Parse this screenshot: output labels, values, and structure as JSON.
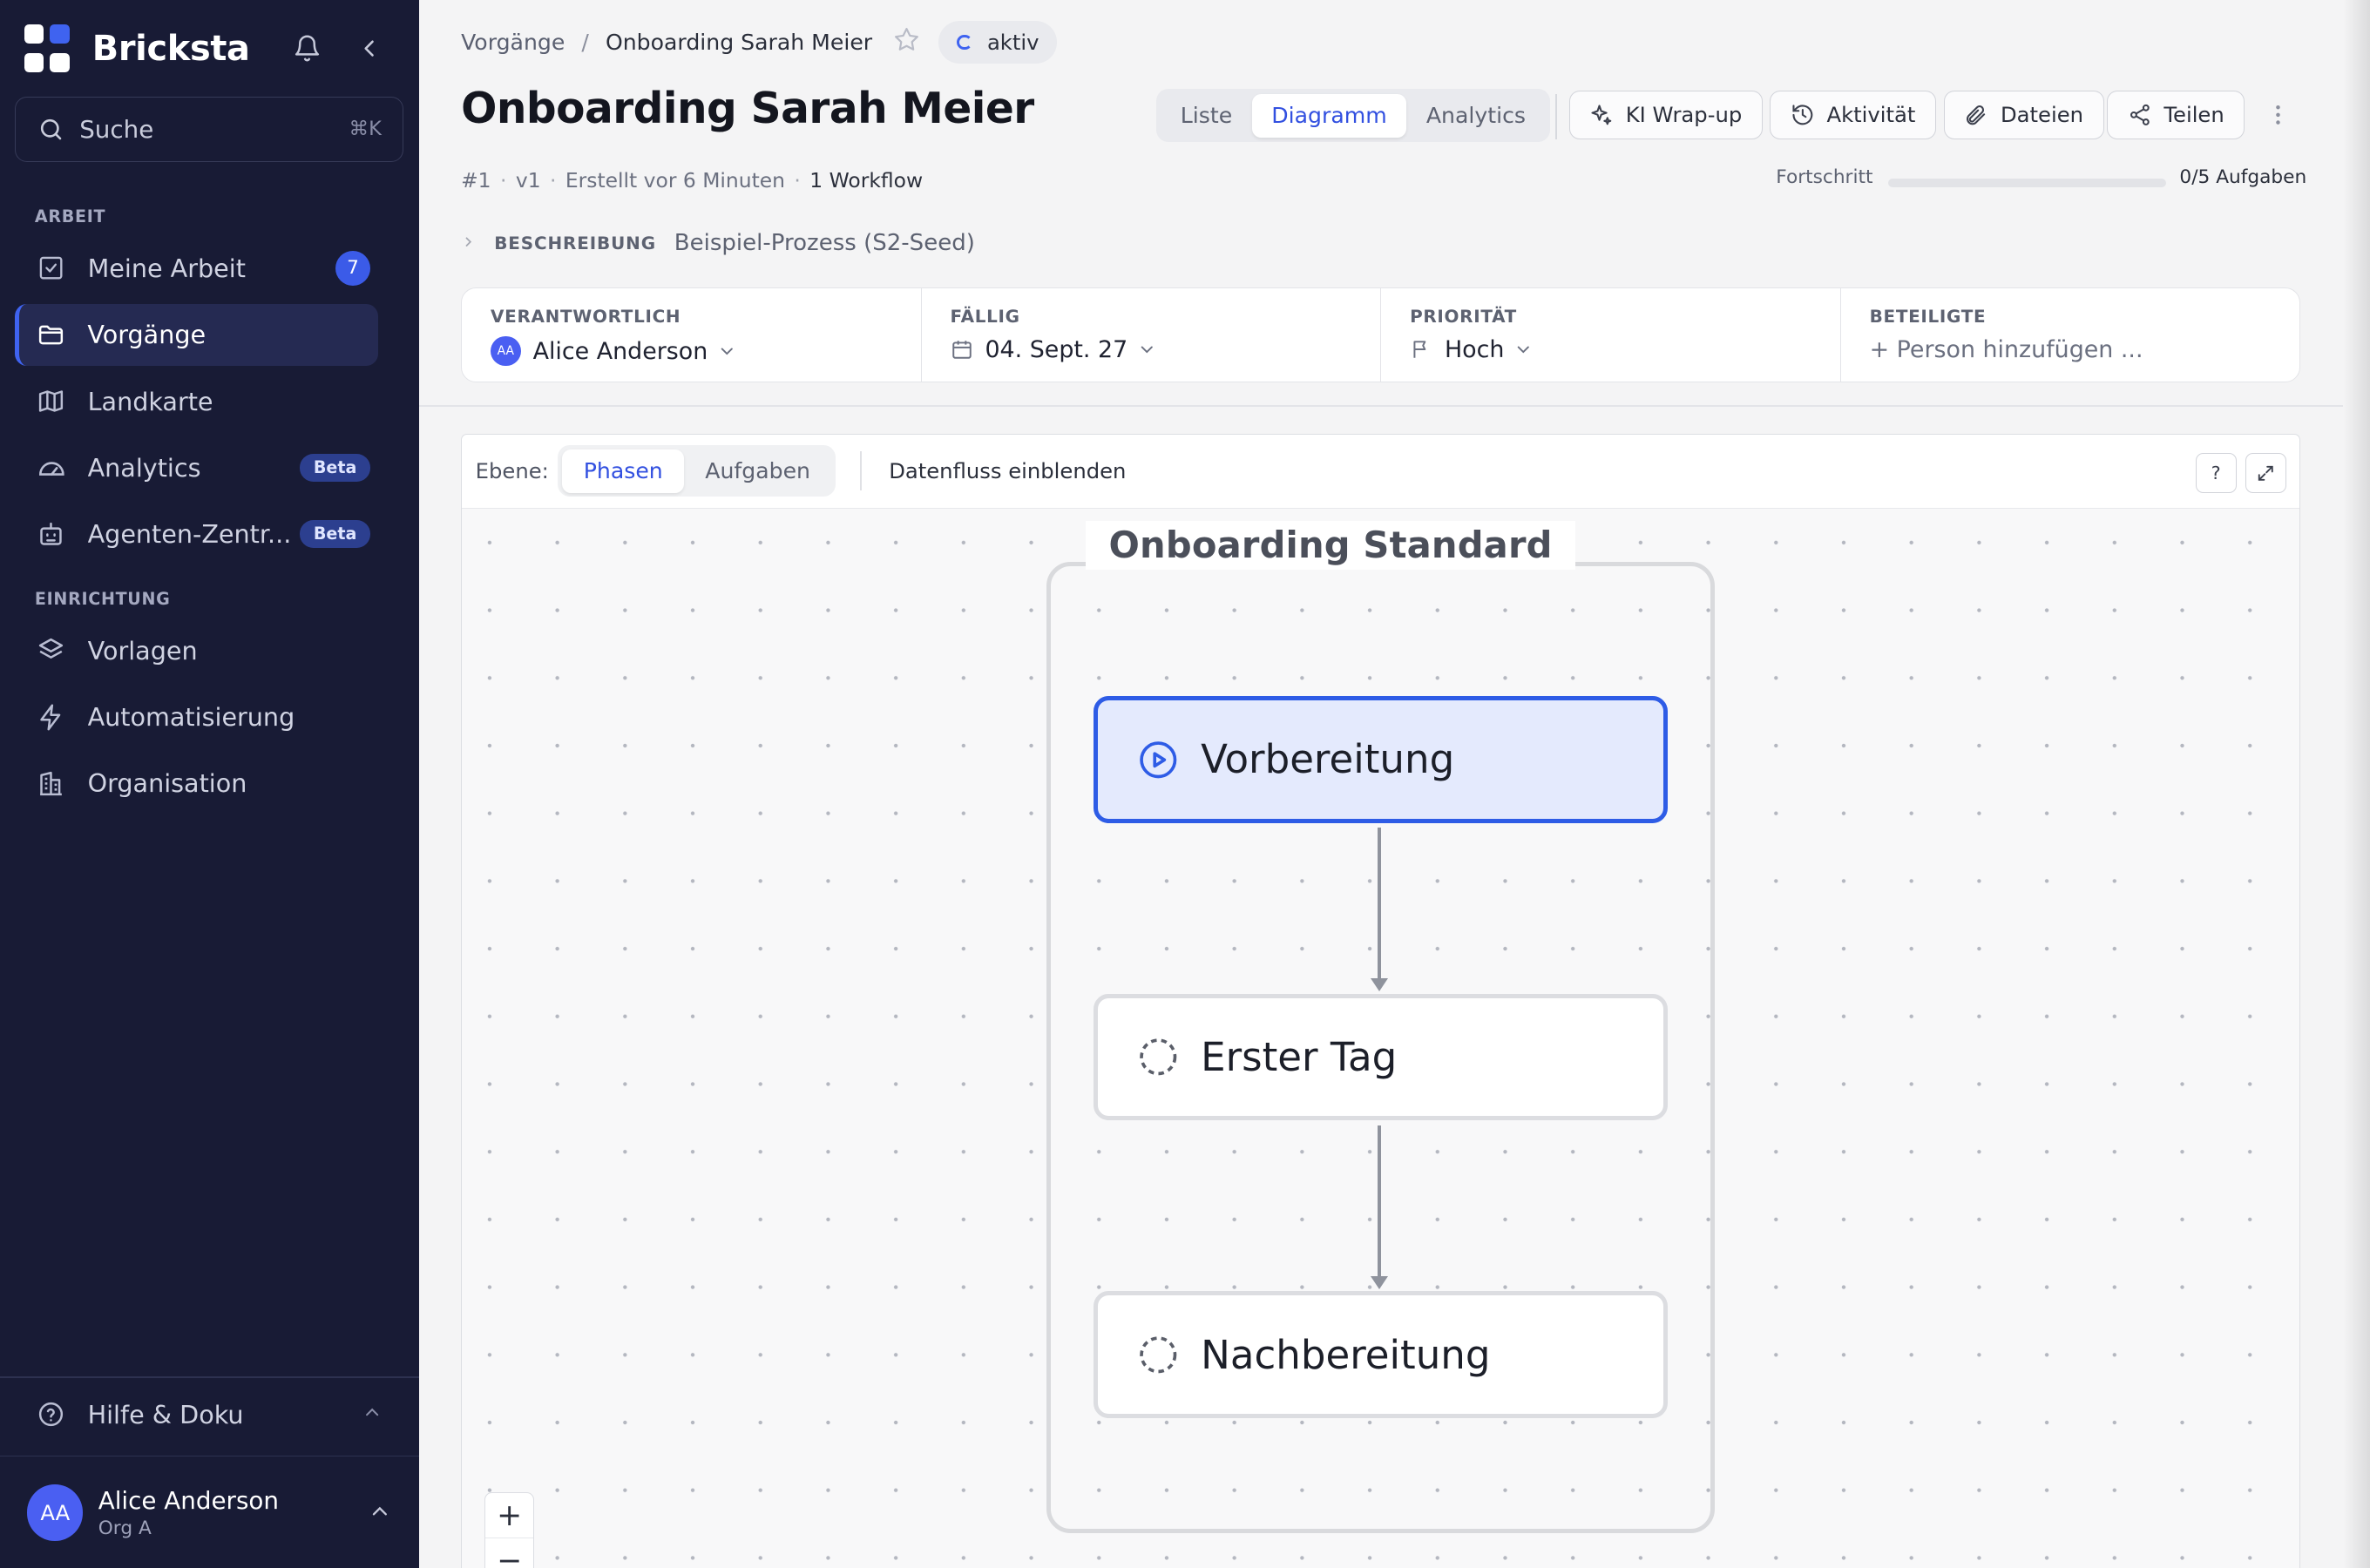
{
  "sidebar": {
    "brand": "Bricksta",
    "search": {
      "label": "Suche",
      "shortcut": "⌘K"
    },
    "sections": {
      "work": "ARBEIT",
      "setup": "EINRICHTUNG"
    },
    "items": [
      {
        "label": "Meine Arbeit",
        "icon": "check-square-icon",
        "badge": "7"
      },
      {
        "label": "Vorgänge",
        "icon": "folder-icon",
        "active": true
      },
      {
        "label": "Landkarte",
        "icon": "map-icon"
      },
      {
        "label": "Analytics",
        "icon": "gauge-icon",
        "badge": "Beta"
      },
      {
        "label": "Agenten-Zentr...",
        "icon": "robot-icon",
        "badge": "Beta"
      },
      {
        "label": "Vorlagen",
        "icon": "layers-icon"
      },
      {
        "label": "Automatisierung",
        "icon": "zap-icon"
      },
      {
        "label": "Organisation",
        "icon": "building-icon"
      }
    ],
    "help": "Hilfe & Doku",
    "user": {
      "initials": "AA",
      "name": "Alice Anderson",
      "org": "Org A"
    }
  },
  "header": {
    "breadcrumb": {
      "root": "Vorgänge",
      "sep": "/",
      "current": "Onboarding Sarah Meier"
    },
    "status": "aktiv",
    "title": "Onboarding Sarah Meier",
    "meta": {
      "id": "#1",
      "version": "v1",
      "created": "Erstellt vor 6 Minuten",
      "workflows": "1 Workflow"
    },
    "views": [
      "Liste",
      "Diagramm",
      "Analytics"
    ],
    "active_view": "Diagramm",
    "actions": {
      "wrapup": "KI Wrap-up",
      "activity": "Aktivität",
      "files": "Dateien",
      "share": "Teilen"
    },
    "progress": {
      "label": "Fortschritt",
      "text": "0/5 Aufgaben",
      "done": 0,
      "total": 5
    }
  },
  "description": {
    "label": "BESCHREIBUNG",
    "value": "Beispiel-Prozess (S2-Seed)"
  },
  "properties": {
    "owner": {
      "label": "VERANTWORTLICH",
      "initials": "AA",
      "value": "Alice Anderson"
    },
    "due": {
      "label": "FÄLLIG",
      "value": "04. Sept. 27"
    },
    "priority": {
      "label": "PRIORITÄT",
      "value": "Hoch"
    },
    "participants": {
      "label": "BETEILIGTE",
      "value": "+ Person hinzufügen ..."
    }
  },
  "diagram": {
    "level_label": "Ebene:",
    "levels": [
      "Phasen",
      "Aufgaben"
    ],
    "active_level": "Phasen",
    "dataflow": "Datenfluss einblenden",
    "help": "?",
    "workflow_title": "Onboarding Standard",
    "phases": [
      {
        "label": "Vorbereitung",
        "state": "active"
      },
      {
        "label": "Erster Tag",
        "state": "pending"
      },
      {
        "label": "Nachbereitung",
        "state": "pending"
      }
    ],
    "accent": "#2e5ce6"
  }
}
